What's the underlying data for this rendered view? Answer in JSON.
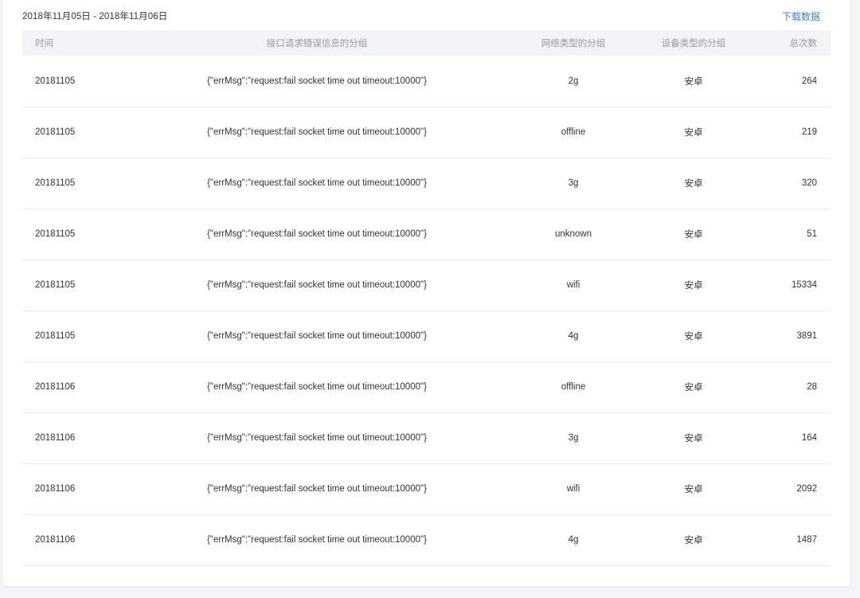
{
  "header": {
    "date_range": "2018年11月05日 - 2018年11月06日",
    "download_label": "下载数据"
  },
  "table": {
    "columns": [
      "时间",
      "接口请求错误信息的分组",
      "网络类型的分组",
      "设备类型的分组",
      "总次数"
    ],
    "rows": [
      {
        "time": "20181105",
        "error": "{\"errMsg\":\"request:fail socket time out timeout:10000\"}",
        "network": "2g",
        "device": "安卓",
        "count": "264"
      },
      {
        "time": "20181105",
        "error": "{\"errMsg\":\"request:fail socket time out timeout:10000\"}",
        "network": "offline",
        "device": "安卓",
        "count": "219"
      },
      {
        "time": "20181105",
        "error": "{\"errMsg\":\"request:fail socket time out timeout:10000\"}",
        "network": "3g",
        "device": "安卓",
        "count": "320"
      },
      {
        "time": "20181105",
        "error": "{\"errMsg\":\"request:fail socket time out timeout:10000\"}",
        "network": "unknown",
        "device": "安卓",
        "count": "51"
      },
      {
        "time": "20181105",
        "error": "{\"errMsg\":\"request:fail socket time out timeout:10000\"}",
        "network": "wifi",
        "device": "安卓",
        "count": "15334"
      },
      {
        "time": "20181105",
        "error": "{\"errMsg\":\"request:fail socket time out timeout:10000\"}",
        "network": "4g",
        "device": "安卓",
        "count": "3891"
      },
      {
        "time": "20181106",
        "error": "{\"errMsg\":\"request:fail socket time out timeout:10000\"}",
        "network": "offline",
        "device": "安卓",
        "count": "28"
      },
      {
        "time": "20181106",
        "error": "{\"errMsg\":\"request:fail socket time out timeout:10000\"}",
        "network": "3g",
        "device": "安卓",
        "count": "164"
      },
      {
        "time": "20181106",
        "error": "{\"errMsg\":\"request:fail socket time out timeout:10000\"}",
        "network": "wifi",
        "device": "安卓",
        "count": "2092"
      },
      {
        "time": "20181106",
        "error": "{\"errMsg\":\"request:fail socket time out timeout:10000\"}",
        "network": "4g",
        "device": "安卓",
        "count": "1487"
      }
    ]
  },
  "colors": {
    "link": "#3e7fd1",
    "header_bg": "#f1f3f6",
    "page_bg": "#f4f5f7"
  }
}
